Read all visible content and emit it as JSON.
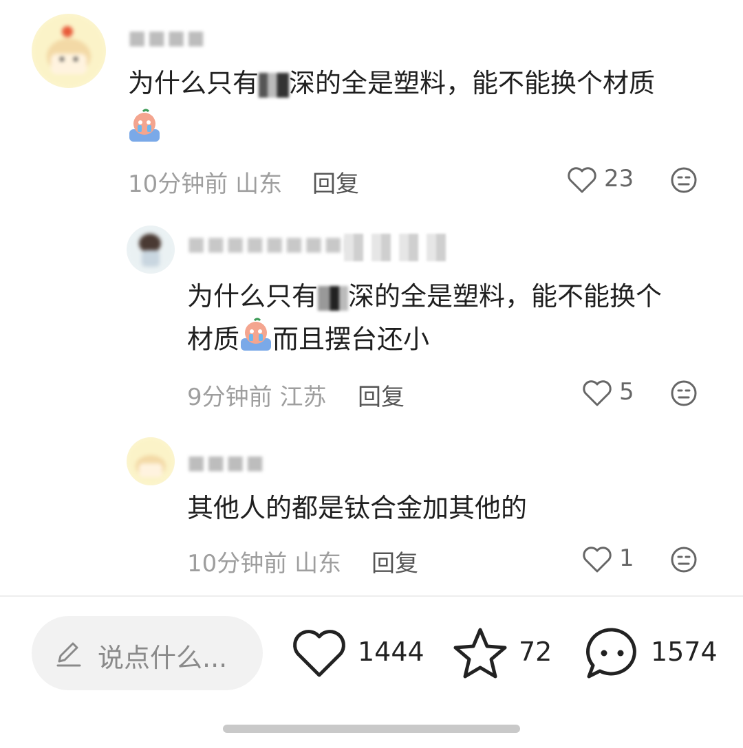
{
  "comments": [
    {
      "username": "■■■■",
      "text_line1": "为什么只有",
      "text_line1_tail": "深的全是塑料，能不能换个材质",
      "time": "10分钟前",
      "location": "山东",
      "reply_label": "回复",
      "like_count": "23"
    },
    {
      "username": "■■■■■■■■■■",
      "text_line1": "为什么只有",
      "text_line1_tail": "深的全是塑料，能不能换个",
      "text_line2_a": "材质",
      "text_line2_b": "而且摆台还小",
      "time": "9分钟前",
      "location": "江苏",
      "reply_label": "回复",
      "like_count": "5"
    },
    {
      "username": "■■■■",
      "text_line1": "其他人的都是钛合金加其他的",
      "time": "10分钟前",
      "location": "山东",
      "reply_label": "回复",
      "like_count": "1"
    }
  ],
  "bottom_bar": {
    "input_placeholder": "说点什么...",
    "like_count": "1444",
    "star_count": "72",
    "comment_count": "1574"
  },
  "icons": {
    "edit": "pencil-icon",
    "like": "heart-icon",
    "star": "star-icon",
    "comment": "chat-bubble-icon",
    "dislike": "neutral-face-icon",
    "sticker": "crying-face-sticker"
  }
}
